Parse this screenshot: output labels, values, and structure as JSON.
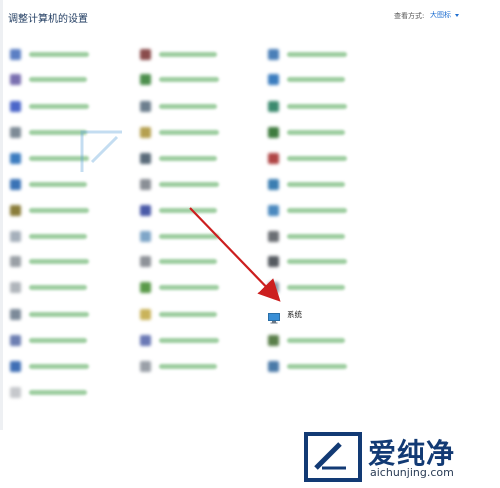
{
  "header": {
    "title": "调整计算机的设置",
    "view_label": "查看方式:",
    "view_value": "大图标"
  },
  "items": [
    {
      "id": "r1c1",
      "blurred": true,
      "color": "#5b7fc4"
    },
    {
      "id": "r1c2",
      "blurred": true,
      "color": "#8a4c4c"
    },
    {
      "id": "r1c3",
      "blurred": true,
      "color": "#4a7fb8"
    },
    {
      "id": "r2c1",
      "blurred": true,
      "color": "#7a6fb0"
    },
    {
      "id": "r2c2",
      "blurred": true,
      "color": "#4d8f4d"
    },
    {
      "id": "r2c3",
      "blurred": true,
      "color": "#3b7dbf"
    },
    {
      "id": "r3c1",
      "blurred": true,
      "color": "#4b66c9"
    },
    {
      "id": "r3c2",
      "blurred": true,
      "color": "#6d7f8e"
    },
    {
      "id": "r3c3",
      "blurred": true,
      "color": "#3c8a6e"
    },
    {
      "id": "r4c1",
      "blurred": true,
      "color": "#7d8a96"
    },
    {
      "id": "r4c2",
      "blurred": true,
      "color": "#b5a04f"
    },
    {
      "id": "r4c3",
      "blurred": true,
      "color": "#3e7b3e"
    },
    {
      "id": "r5c1",
      "blurred": true,
      "color": "#3c7cc0"
    },
    {
      "id": "r5c2",
      "blurred": true,
      "color": "#5a6b7a"
    },
    {
      "id": "r5c3",
      "blurred": true,
      "color": "#b04545"
    },
    {
      "id": "r6c1",
      "blurred": true,
      "color": "#3a73b6"
    },
    {
      "id": "r6c2",
      "blurred": true,
      "color": "#8a8f96"
    },
    {
      "id": "r6c3",
      "blurred": true,
      "color": "#3b7eb2"
    },
    {
      "id": "r7c1",
      "blurred": true,
      "color": "#8a7d3a"
    },
    {
      "id": "r7c2",
      "blurred": true,
      "color": "#4a5aa8"
    },
    {
      "id": "r7c3",
      "blurred": true,
      "color": "#4b89bf"
    },
    {
      "id": "r8c1",
      "blurred": true,
      "color": "#a6b0bb"
    },
    {
      "id": "r8c2",
      "blurred": true,
      "color": "#7fa6c8"
    },
    {
      "id": "r8c3",
      "blurred": true,
      "color": "#6b6f74"
    },
    {
      "id": "r9c1",
      "blurred": true,
      "color": "#9aa0a6"
    },
    {
      "id": "r9c2",
      "blurred": true,
      "color": "#8e9298"
    },
    {
      "id": "r9c3",
      "blurred": true,
      "color": "#555a60"
    },
    {
      "id": "r10c1",
      "blurred": true,
      "color": "#b0b5bb"
    },
    {
      "id": "r10c2",
      "blurred": true,
      "color": "#5a9a4a"
    },
    {
      "id": "r10c3",
      "blurred": true,
      "color": "#8a9aa8"
    },
    {
      "id": "r11c1",
      "blurred": true,
      "color": "#7c8a99"
    },
    {
      "id": "r11c2",
      "blurred": true,
      "color": "#c9b35a"
    },
    {
      "id": "r11c3",
      "blurred": false,
      "color": "#3a8fd6",
      "label": "系统"
    },
    {
      "id": "r12c1",
      "blurred": true,
      "color": "#6d7fb2"
    },
    {
      "id": "r12c2",
      "blurred": true,
      "color": "#6a79b5"
    },
    {
      "id": "r12c3",
      "blurred": true,
      "color": "#5a7f4a"
    },
    {
      "id": "r13c1",
      "blurred": true,
      "color": "#3f6fb5"
    },
    {
      "id": "r13c2",
      "blurred": true,
      "color": "#9aa0a8"
    },
    {
      "id": "r13c3",
      "blurred": true,
      "color": "#4a7aa8"
    },
    {
      "id": "r14c1",
      "blurred": true,
      "color": "#c6c8cc"
    }
  ],
  "watermark": {
    "brand": "爱纯净",
    "url": "aichunjing.com"
  }
}
